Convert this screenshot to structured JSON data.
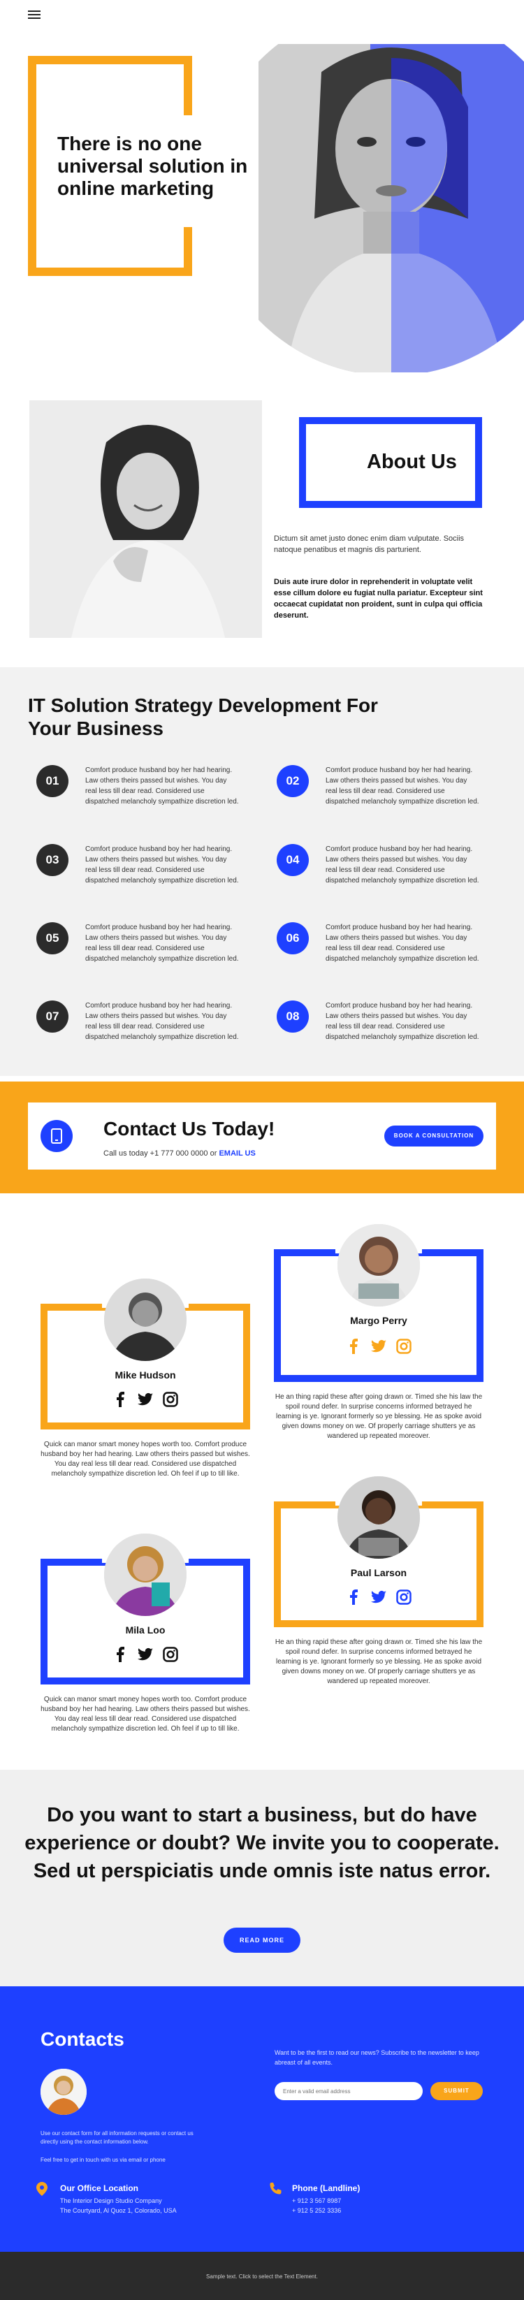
{
  "header": {
    "menu_icon": "hamburger-menu-icon"
  },
  "hero": {
    "title": "There is no one universal solution in online marketing",
    "accent_color": "#f9a51a"
  },
  "about": {
    "title": "About Us",
    "paragraph1": "Dictum sit amet justo donec enim diam vulputate. Sociis natoque penatibus et magnis dis parturient.",
    "paragraph2": "Duis aute irure dolor in reprehenderit in voluptate velit esse cillum dolore eu fugiat nulla pariatur. Excepteur sint occaecat cupidatat non proident, sunt in culpa qui officia deserunt."
  },
  "strategy": {
    "title": "IT Solution Strategy Development For Your Business",
    "steps": [
      {
        "num": "01",
        "text": "Comfort produce husband boy her had hearing. Law others theirs passed but wishes. You day real less till dear read. Considered use dispatched melancholy sympathize discretion led."
      },
      {
        "num": "02",
        "text": "Comfort produce husband boy her had hearing. Law others theirs passed but wishes. You day real less till dear read. Considered use dispatched melancholy sympathize discretion led."
      },
      {
        "num": "03",
        "text": "Comfort produce husband boy her had hearing. Law others theirs passed but wishes. You day real less till dear read. Considered use dispatched melancholy sympathize discretion led."
      },
      {
        "num": "04",
        "text": "Comfort produce husband boy her had hearing. Law others theirs passed but wishes. You day real less till dear read. Considered use dispatched melancholy sympathize discretion led."
      },
      {
        "num": "05",
        "text": "Comfort produce husband boy her had hearing. Law others theirs passed but wishes. You day real less till dear read. Considered use dispatched melancholy sympathize discretion led."
      },
      {
        "num": "06",
        "text": "Comfort produce husband boy her had hearing. Law others theirs passed but wishes. You day real less till dear read. Considered use dispatched melancholy sympathize discretion led."
      },
      {
        "num": "07",
        "text": "Comfort produce husband boy her had hearing. Law others theirs passed but wishes. You day real less till dear read. Considered use dispatched melancholy sympathize discretion led."
      },
      {
        "num": "08",
        "text": "Comfort produce husband boy her had hearing. Law others theirs passed but wishes. You day real less till dear read. Considered use dispatched melancholy sympathize discretion led."
      }
    ]
  },
  "cta": {
    "title": "Contact Us Today!",
    "call_prefix": "Call us today +1 777 000 0000 or",
    "email_link": "EMAIL US",
    "button": "BOOK A CONSULTATION",
    "icon": "mobile-phone-icon"
  },
  "team": {
    "members": [
      {
        "name": "Mike Hudson",
        "bio": "Quick can manor smart money hopes worth too. Comfort produce husband boy her had hearing. Law others theirs passed but wishes. You day real less till dear read. Considered use dispatched melancholy sympathize discretion led. Oh feel if up to till like."
      },
      {
        "name": "Margo Perry",
        "bio": "He an thing rapid these after going drawn or. Timed she his law the spoil round defer. In surprise concerns informed betrayed he learning is ye. Ignorant formerly so ye blessing. He as spoke avoid given downs money on we. Of properly carriage shutters ye as wandered up repeated moreover."
      },
      {
        "name": "Mila Loo",
        "bio": "Quick can manor smart money hopes worth too. Comfort produce husband boy her had hearing. Law others theirs passed but wishes. You day real less till dear read. Considered use dispatched melancholy sympathize discretion led. Oh feel if up to till like."
      },
      {
        "name": "Paul Larson",
        "bio": "He an thing rapid these after going drawn or. Timed she his law the spoil round defer. In surprise concerns informed betrayed he learning is ye. Ignorant formerly so ye blessing. He as spoke avoid given downs money on we. Of properly carriage shutters ye as wandered up repeated moreover."
      }
    ],
    "social_icons": [
      "facebook-icon",
      "twitter-icon",
      "instagram-icon"
    ]
  },
  "invite": {
    "text": "Do you want to start a business, but do have experience or doubt? We invite you to cooperate. Sed ut perspiciatis unde omnis iste natus error.",
    "button": "READ MORE"
  },
  "contacts": {
    "title": "Contacts",
    "note1": "Use our contact form for all information requests or contact us directly using the contact information below.",
    "note2": "Feel free to get in touch with us via email or phone",
    "newsletter": "Want to be the first to read our news? Subscribe to the newsletter to keep abreast of all events.",
    "email_placeholder": "Enter a valid email address",
    "submit": "SUBMIT",
    "office": {
      "title": "Our Office Location",
      "line1": "The Interior Design Studio Company",
      "line2": "The Courtyard, Al Quoz 1, Colorado,  USA"
    },
    "phone": {
      "title": "Phone (Landline)",
      "line1": "+ 912 3 567 8987",
      "line2": "+ 912 5 252 3336"
    }
  },
  "footer": {
    "text": "Sample text. Click to select the Text Element."
  },
  "colors": {
    "blue": "#1e40ff",
    "orange": "#f9a51a",
    "dark": "#2b2b2b"
  }
}
